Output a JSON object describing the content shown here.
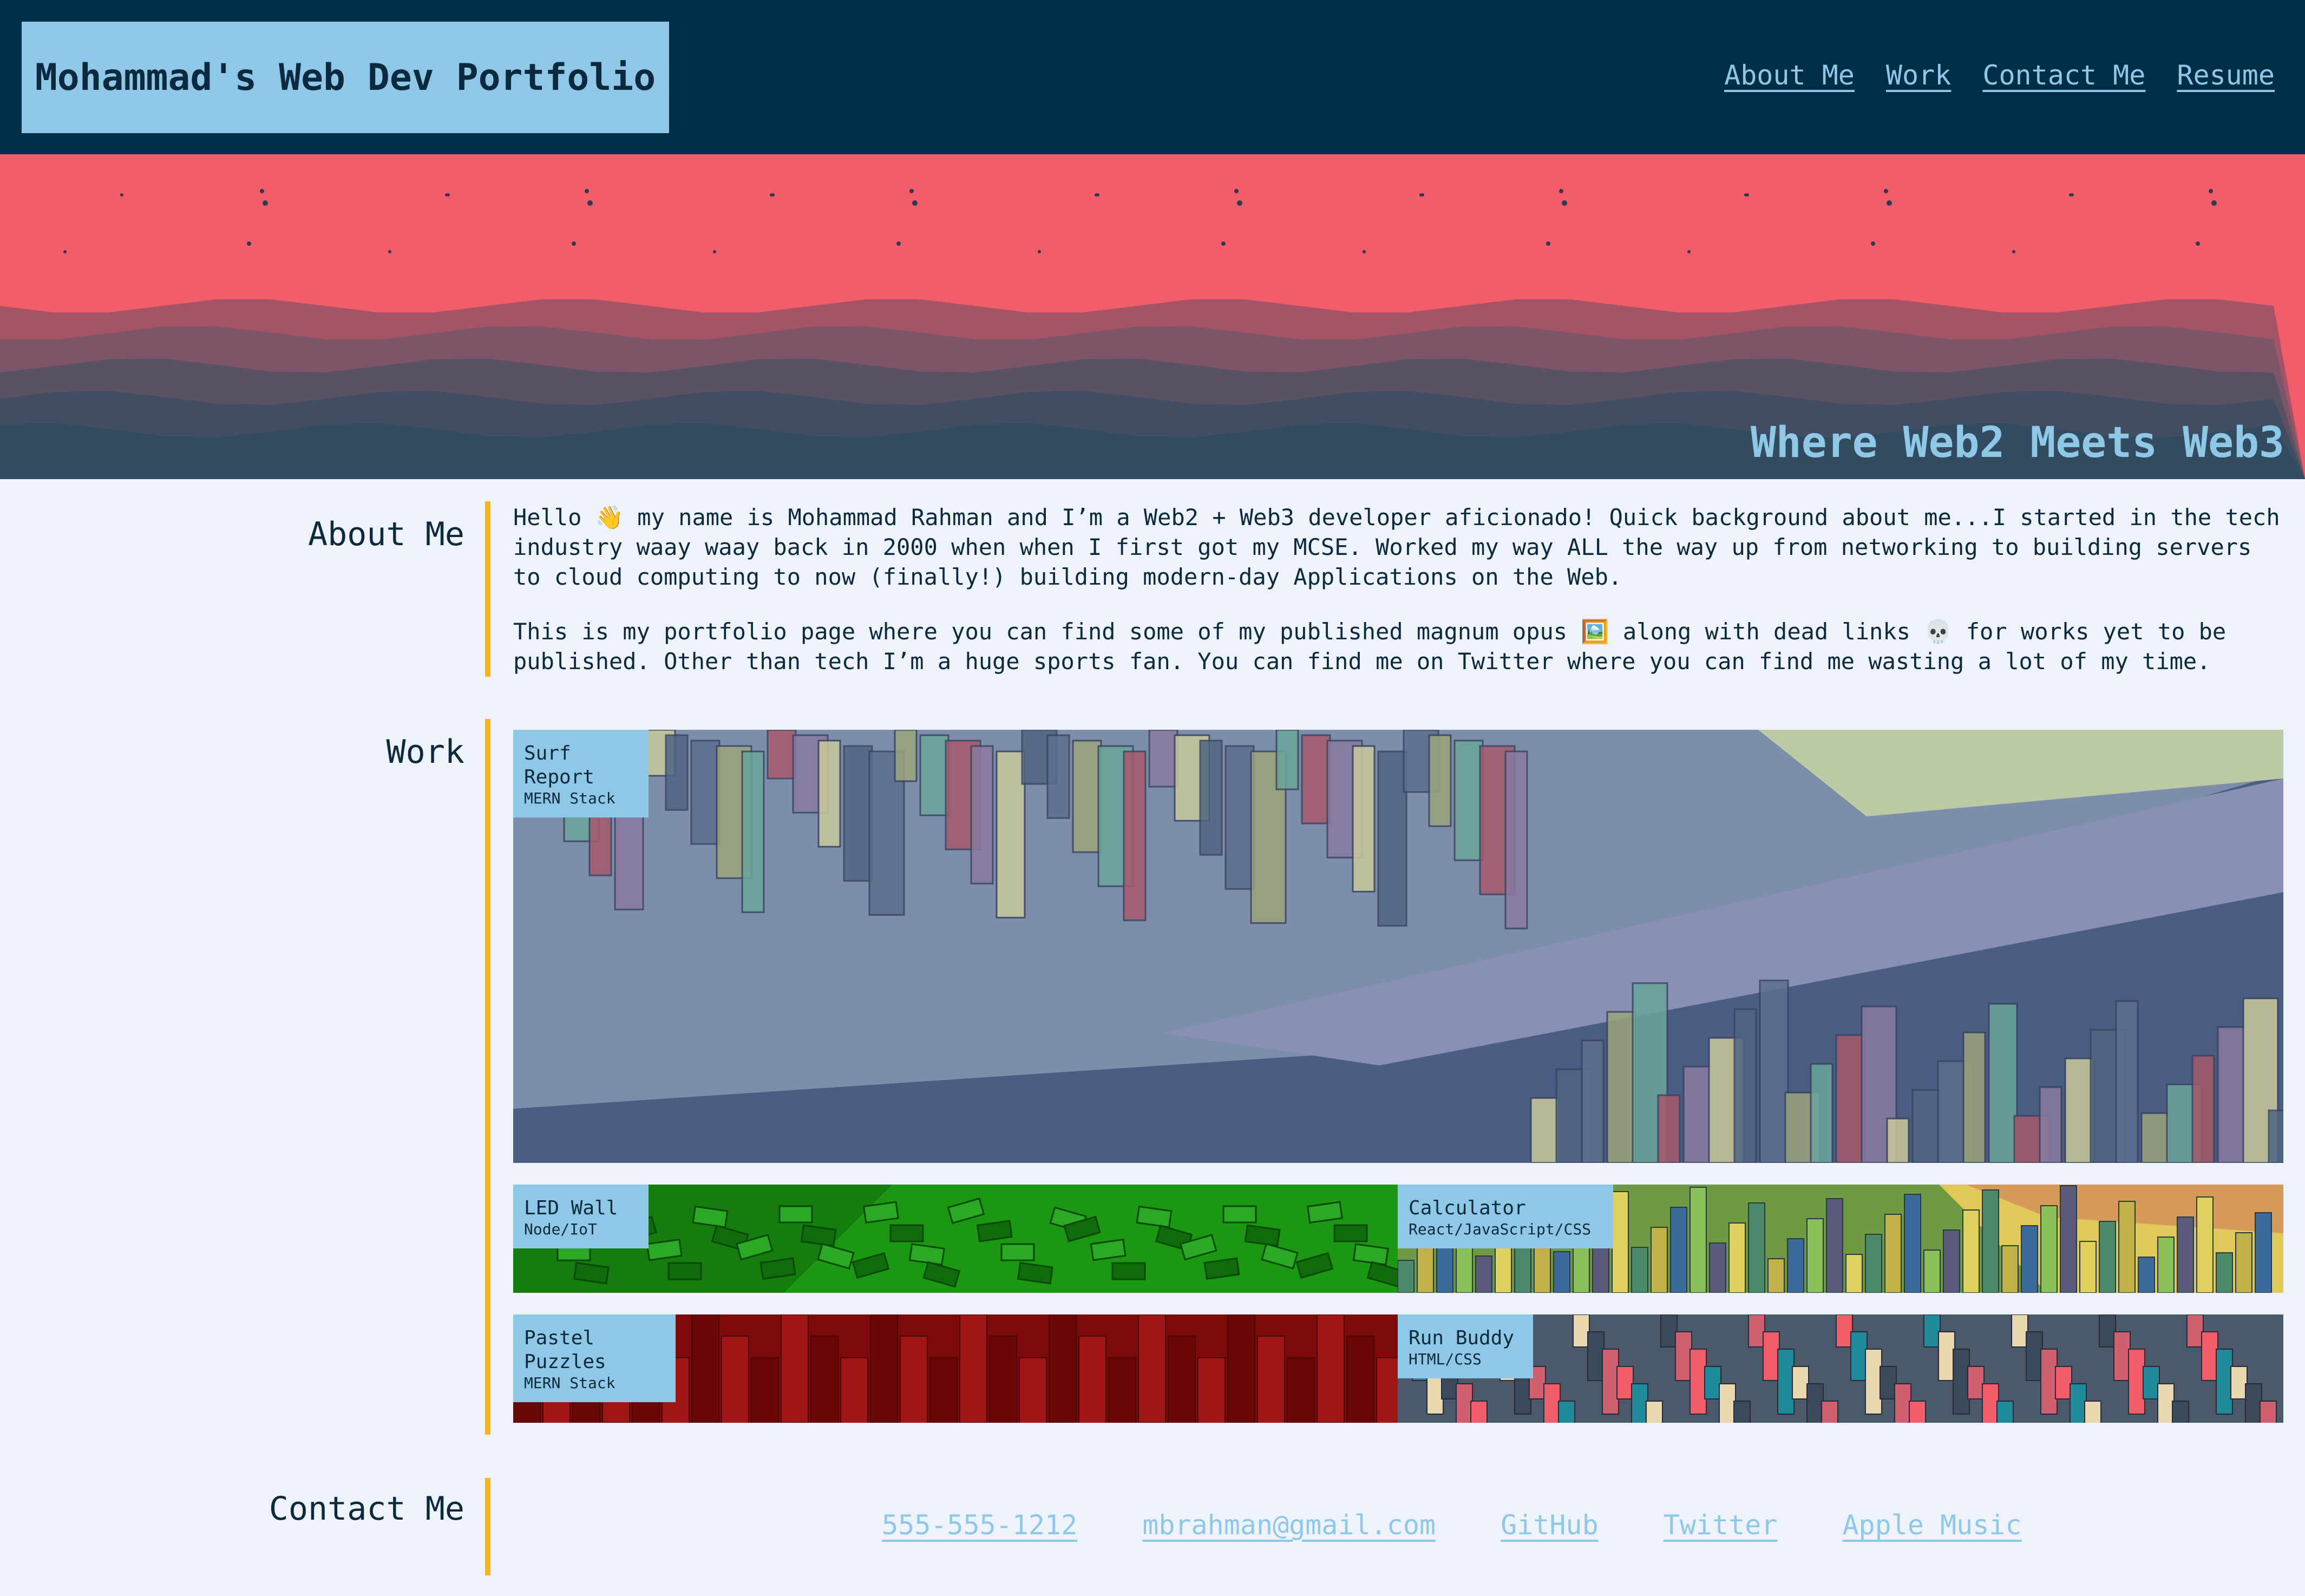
{
  "header": {
    "brand": "Mohammad's Web Dev Portfolio",
    "nav": [
      "About Me",
      "Work",
      "Contact Me",
      "Resume"
    ]
  },
  "hero": {
    "tagline": "Where Web2 Meets Web3"
  },
  "about": {
    "title": "About Me",
    "paragraphs": [
      "Hello 👋 my name is Mohammad Rahman and I’m a Web2 + Web3 developer aficionado! Quick background about me...I started in the tech industry waay waay back in 2000 when when I first got my MCSE. Worked my way ALL the way up from networking to building servers to cloud computing to now (finally!) building modern-day Applications on the Web.",
      "This is my portfolio page where you can find some of my published magnum opus 🖼️ along with dead links 💀 for works yet to be published. Other than tech I’m a huge sports fan. You can find me on Twitter where you can find me wasting a lot of my time."
    ]
  },
  "work": {
    "title": "Work",
    "projects": [
      {
        "title": "Surf Report",
        "tech": "MERN Stack"
      },
      {
        "title": "LED Wall",
        "tech": "Node/IoT"
      },
      {
        "title": "Calculator",
        "tech": "React/JavaScript/CSS"
      },
      {
        "title": "Pastel Puzzles",
        "tech": "MERN Stack"
      },
      {
        "title": "Run Buddy",
        "tech": "HTML/CSS"
      }
    ]
  },
  "contact": {
    "title": "Contact Me",
    "links": [
      "555-555-1212",
      "mbrahman@gmail.com",
      "GitHub",
      "Twitter",
      "Apple Music"
    ]
  },
  "colors": {
    "header_bg": "#002e48",
    "accent_blue": "#8ec8e6",
    "hero_red": "#f25d6a",
    "section_bar": "#f5b519",
    "page_bg": "#eef2fa"
  },
  "icons": [
    "waving-hand-icon",
    "framed-picture-icon",
    "skull-icon"
  ]
}
